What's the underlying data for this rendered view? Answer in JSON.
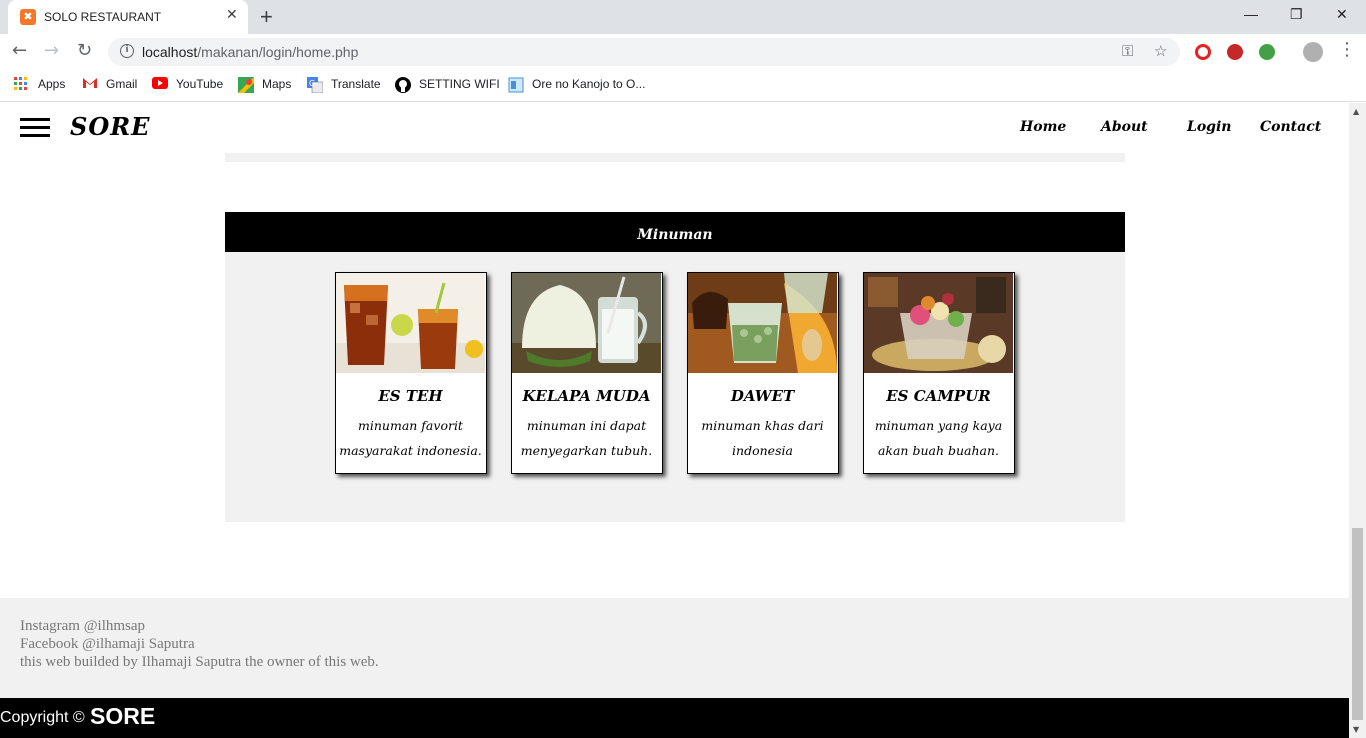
{
  "browser": {
    "tab_title": "SOLO RESTAURANT",
    "tab_close": "✕",
    "new_tab": "+",
    "url_host": "localhost",
    "url_path": "/makanan/login/home.php",
    "window_controls": {
      "minimize": "—",
      "restore": "❐",
      "close": "✕"
    },
    "bookmarks": [
      {
        "label": "Apps",
        "icon": "apps-grid-icon"
      },
      {
        "label": "Gmail",
        "icon": "gmail-icon"
      },
      {
        "label": "YouTube",
        "icon": "youtube-icon"
      },
      {
        "label": "Maps",
        "icon": "maps-icon"
      },
      {
        "label": "Translate",
        "icon": "translate-icon"
      },
      {
        "label": "SETTING WIFI",
        "icon": "github-icon"
      },
      {
        "label": "Ore no Kanojo to O...",
        "icon": "page-icon"
      }
    ]
  },
  "site": {
    "brand": "SORE",
    "menu": [
      "Home",
      "About",
      "Login",
      "Contact"
    ]
  },
  "section": {
    "title": "Minuman",
    "items": [
      {
        "title": "ES TEH",
        "desc": "minuman favorit masyarakat indonesia.",
        "image": "iced-tea-photo"
      },
      {
        "title": "KELAPA MUDA",
        "desc": "minuman ini dapat menyegarkan tubuh.",
        "image": "young-coconut-photo"
      },
      {
        "title": "DAWET",
        "desc": "minuman khas dari indonesia",
        "image": "dawet-photo"
      },
      {
        "title": "ES CAMPUR",
        "desc": "minuman yang kaya akan buah buahan.",
        "image": "es-campur-photo"
      }
    ]
  },
  "footer": {
    "lines": [
      "Instagram @ilhmsap",
      "Facebook @ilhamaji Saputra",
      "this web builded by Ilhamaji Saputra the owner of this web."
    ],
    "copyright_text": "Copyright ©",
    "copyright_brand": "SORE"
  },
  "colors": {
    "accent_tab_favicon": "#f4772a",
    "section_header": "#000000",
    "panel_bg": "#f1f1f1"
  }
}
